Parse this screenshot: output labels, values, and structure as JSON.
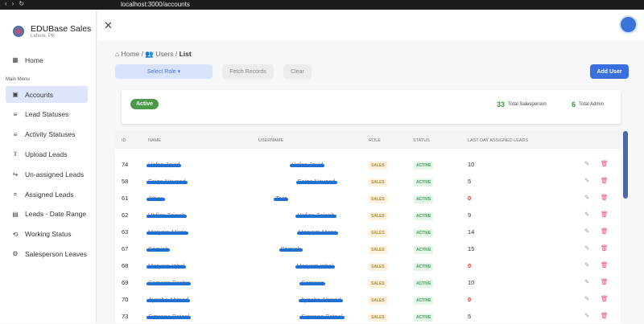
{
  "browser": {
    "url": "localhost:3000/accounts"
  },
  "brand": {
    "name": "EDUBase Sales",
    "location": "Lahore, PK"
  },
  "sidebar": {
    "home": "Home",
    "menu_label": "Main Menu",
    "items": [
      {
        "label": "Accounts",
        "icon": "user-card-icon",
        "glyph": "▣"
      },
      {
        "label": "Lead Statuses",
        "icon": "list-icon",
        "glyph": "≡"
      },
      {
        "label": "Activity Statuses",
        "icon": "list-icon",
        "glyph": "≡"
      },
      {
        "label": "Upload Leads",
        "icon": "upload-icon",
        "glyph": "⇪"
      },
      {
        "label": "Un-assigned Leads",
        "icon": "unlink-icon",
        "glyph": "⇋"
      },
      {
        "label": "Assigned Leads",
        "icon": "list-icon",
        "glyph": "="
      },
      {
        "label": "Leads - Date Range",
        "icon": "calendar-icon",
        "glyph": "▤"
      },
      {
        "label": "Working Status",
        "icon": "refresh-icon",
        "glyph": "⟲"
      },
      {
        "label": "Salesperson Leaves",
        "icon": "leave-icon",
        "glyph": "⚙"
      }
    ]
  },
  "breadcrumb": {
    "home": "Home",
    "users": "Users",
    "list": "List"
  },
  "toolbar": {
    "select_role": "Select Role",
    "fetch": "Fetch Records",
    "clear": "Clear",
    "add_user": "Add User"
  },
  "summary": {
    "status": "Active",
    "salesperson_count": "33",
    "salesperson_label": "Total Salesperson",
    "admin_count": "6",
    "admin_label": "Total Admin"
  },
  "table": {
    "headers": [
      "ID",
      "NAME",
      "USERNAME",
      "ROLE",
      "STATUS",
      "LAST DAY ASSIGNED LEADS"
    ],
    "rows": [
      {
        "id": "74",
        "name": "Hafsa Javid",
        "username": "Hafsa Javid",
        "role": "SALES",
        "status": "ACTIVE",
        "leads": "10"
      },
      {
        "id": "58",
        "name": "Faiqa Naveed",
        "username": "Faiqa Naveed",
        "role": "SALES",
        "status": "ACTIVE",
        "leads": "5"
      },
      {
        "id": "61",
        "name": "Attiqa",
        "username": "Test",
        "role": "SALES",
        "status": "ACTIVE",
        "leads": "0"
      },
      {
        "id": "62",
        "name": "Hafiza Zainab",
        "username": "Hafiza Zainab",
        "role": "SALES",
        "status": "ACTIVE",
        "leads": "9"
      },
      {
        "id": "63",
        "name": "Maryam Mirza",
        "username": "Maryam Mirza",
        "role": "SALES",
        "status": "ACTIVE",
        "leads": "14"
      },
      {
        "id": "67",
        "name": "Samiah",
        "username": "Samiah",
        "role": "SALES",
        "status": "ACTIVE",
        "leads": "15"
      },
      {
        "id": "68",
        "name": "Maryam Iqbal",
        "username": "Maryam Iqbal",
        "role": "SALES",
        "status": "ACTIVE",
        "leads": "0"
      },
      {
        "id": "69",
        "name": "Samana Bashir",
        "username": "Samana",
        "role": "SALES",
        "status": "ACTIVE",
        "leads": "10"
      },
      {
        "id": "70",
        "name": "Ayesha Ahmad",
        "username": "Ayesha Ahmad",
        "role": "SALES",
        "status": "ACTIVE",
        "leads": "0"
      },
      {
        "id": "73",
        "name": "Simrana Batool",
        "username": "Simrana Batool",
        "role": "SALES",
        "status": "ACTIVE",
        "leads": "5"
      }
    ]
  }
}
